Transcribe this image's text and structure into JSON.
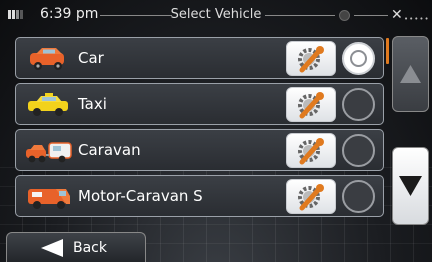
{
  "status": {
    "time": "6:39 pm",
    "title": "Select Vehicle"
  },
  "vehicles": [
    {
      "label": "Car",
      "icon": "car-icon",
      "selected": true,
      "color": "#e8622a"
    },
    {
      "label": "Taxi",
      "icon": "taxi-icon",
      "selected": false,
      "color": "#f2d21c"
    },
    {
      "label": "Caravan",
      "icon": "caravan-icon",
      "selected": false,
      "color": "#e8622a"
    },
    {
      "label": "Motor-Caravan S",
      "icon": "motor-caravan-icon",
      "selected": false,
      "color": "#e8622a"
    }
  ],
  "nav": {
    "back_label": "Back"
  },
  "colors": {
    "accent": "#e07a1f",
    "row_border": "#9aa0a8"
  }
}
